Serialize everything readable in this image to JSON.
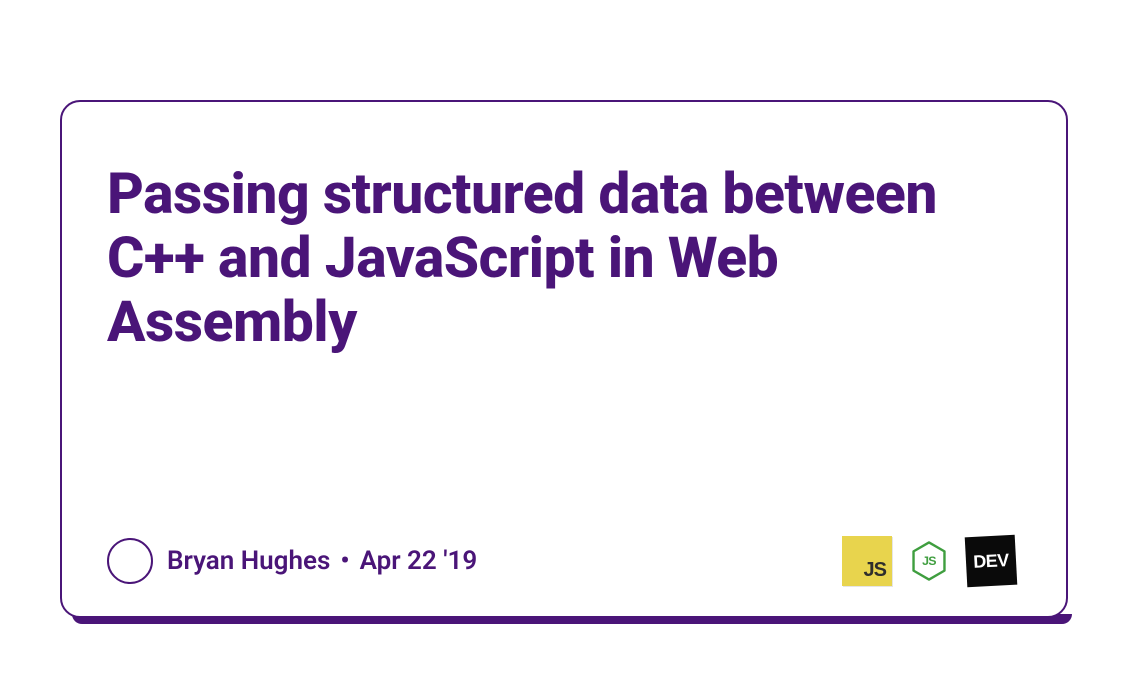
{
  "article": {
    "title": "Passing structured data between C++ and JavaScript in Web Assembly",
    "author": "Bryan Hughes",
    "date": "Apr 22 '19"
  },
  "badges": {
    "js": "JS",
    "node": "node-icon",
    "dev": "DEV"
  },
  "colors": {
    "accent": "#4a1578",
    "js_bg": "#e8d44d",
    "node_stroke": "#3f9e3f",
    "dev_bg": "#0a0a0a"
  }
}
